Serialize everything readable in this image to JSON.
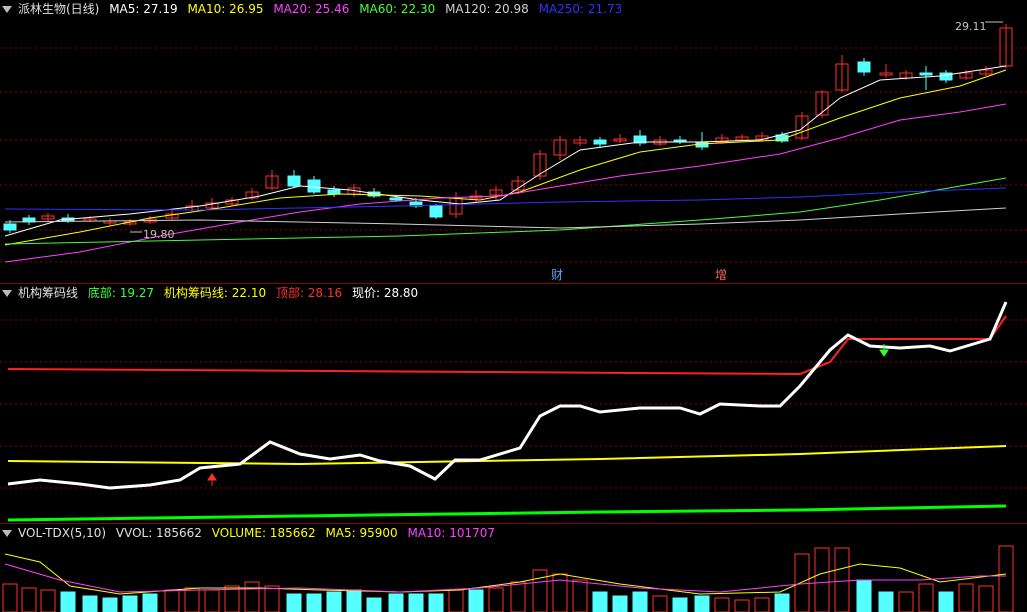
{
  "main": {
    "title": "派林生物(日线)",
    "ma": [
      {
        "label": "MA5: 27.19",
        "color": "#ffffff"
      },
      {
        "label": "MA10: 26.95",
        "color": "#ffff00"
      },
      {
        "label": "MA20: 25.46",
        "color": "#ff40ff"
      },
      {
        "label": "MA60: 22.30",
        "color": "#40ff40"
      },
      {
        "label": "MA120: 20.98",
        "color": "#d0d0d0"
      },
      {
        "label": "MA250: 21.73",
        "color": "#3030ff"
      }
    ],
    "high_label": "29.11",
    "low_label": "19.80",
    "marker_cai": "财",
    "marker_zeng": "增"
  },
  "indicator": {
    "title": "机构筹码线",
    "bottom": "底部: 19.27",
    "line": "机构筹码线: 22.10",
    "top": "顶部: 28.16",
    "price": "现价: 28.80"
  },
  "volume": {
    "title": "VOL-TDX(5,10)",
    "vvol": "VVOL: 185662",
    "volume": "VOLUME: 185662",
    "ma5": "MA5: 95900",
    "ma10": "MA10: 101707"
  },
  "colors": {
    "up": "#ff3030",
    "down": "#54ffff",
    "grid": "#8b0000"
  }
}
